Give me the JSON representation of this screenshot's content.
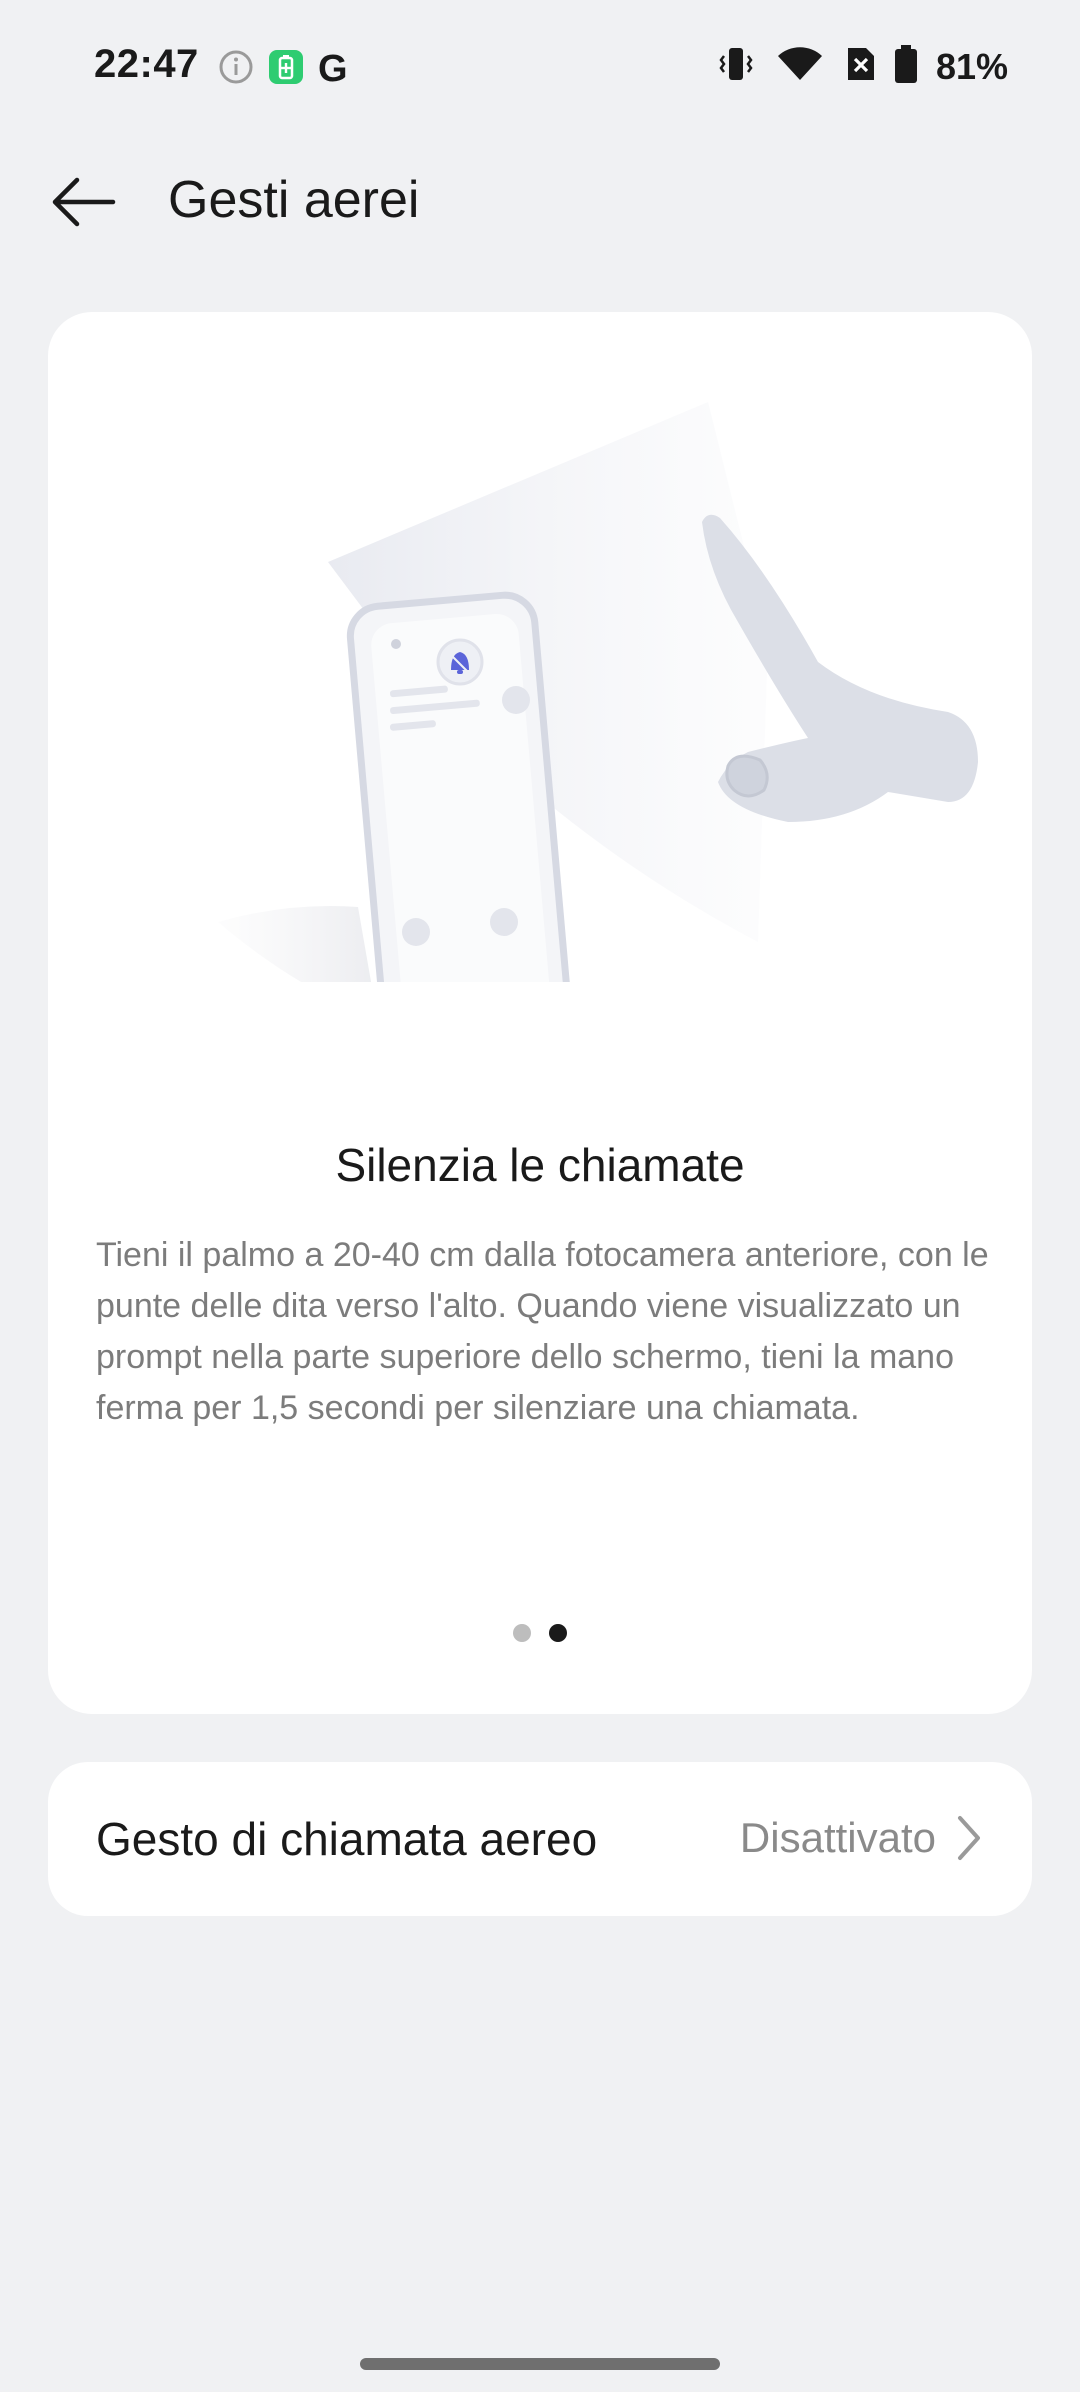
{
  "status_bar": {
    "time": "22:47",
    "battery_percent": "81%",
    "left_icons": [
      "info-icon",
      "battery-saver-icon",
      "google-icon"
    ],
    "right_icons": [
      "vibrate-icon",
      "wifi-icon",
      "no-sim-icon",
      "battery-icon"
    ],
    "google_letter": "G"
  },
  "header": {
    "title": "Gesti aerei"
  },
  "card": {
    "title": "Silenzia le chiamate",
    "description": "Tieni il palmo a 20-40 cm dalla fotocamera anteriore, con le punte delle dita verso l'alto. Quando viene visualizzato un prompt nella parte superiore dello schermo, tieni la mano ferma per 1,5 secondi per silenziare una chiamata.",
    "pager": {
      "total": 2,
      "active_index": 1
    }
  },
  "setting": {
    "label": "Gesto di chiamata aereo",
    "value": "Disattivato"
  },
  "colors": {
    "background": "#f0f1f3",
    "card": "#ffffff",
    "accent_icon": "#5b64d9",
    "battery_saver": "#2ecc71"
  }
}
